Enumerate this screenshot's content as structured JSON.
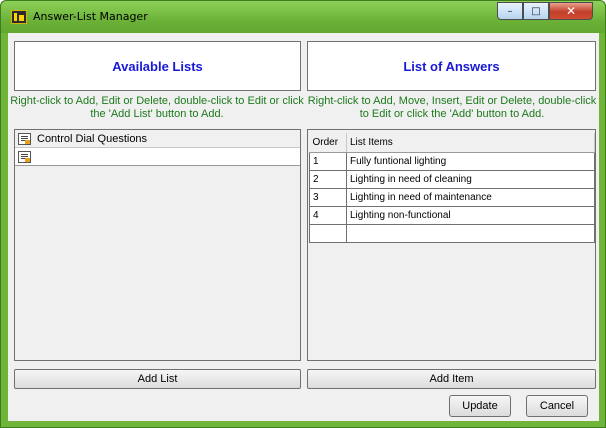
{
  "window": {
    "title": "Answer-List Manager",
    "icon": "app-logo-icon",
    "controls": {
      "minimize": "–",
      "maximize": "□",
      "close": "✕"
    }
  },
  "available": {
    "header": "Available Lists",
    "hint": "Right-click to Add, Edit or Delete, double-click to Edit or click the 'Add List' button to Add.",
    "items": [
      {
        "label": "Control Dial Questions",
        "icon": "list-icon"
      },
      {
        "label": "",
        "icon": "list-icon"
      }
    ],
    "add_button": "Add List"
  },
  "answers": {
    "header": "List of Answers",
    "hint": "Right-click to Add, Move, Insert, Edit or Delete, double-click to Edit or click the 'Add' button to Add.",
    "columns": [
      "Order",
      "List Items"
    ],
    "rows": [
      {
        "order": "1",
        "item": "Fully funtional lighting"
      },
      {
        "order": "2",
        "item": "Lighting in need of cleaning"
      },
      {
        "order": "3",
        "item": "Lighting in need of maintenance"
      },
      {
        "order": "4",
        "item": "Lighting non-functional"
      },
      {
        "order": "",
        "item": ""
      }
    ],
    "add_button": "Add Item"
  },
  "footer": {
    "update_button": "Update",
    "cancel_button": "Cancel"
  },
  "colors": {
    "titlebar": "#6cb238",
    "header_text": "#1a1ad6",
    "hint_text": "#1d7a1d"
  }
}
